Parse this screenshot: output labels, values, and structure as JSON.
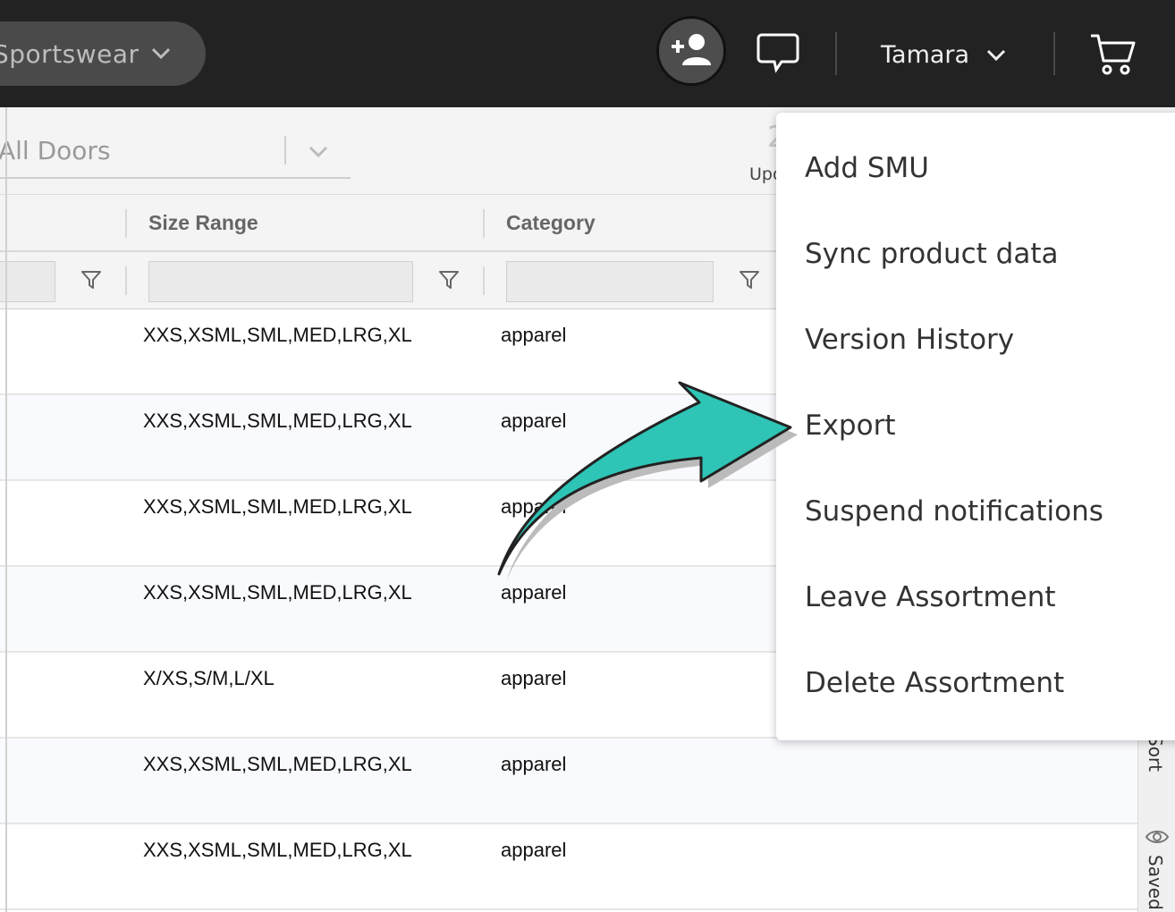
{
  "header": {
    "collection_label": "Sportswear",
    "user_name": "Tamara"
  },
  "toolbar": {
    "doors_label": "All Doors",
    "partial_count": "2",
    "partial_update_label": "Upo"
  },
  "table": {
    "columns": [
      {
        "label": "Size Range"
      },
      {
        "label": "Category"
      }
    ],
    "rows": [
      {
        "size_range": "XXS,XSML,SML,MED,LRG,XL",
        "category": "apparel"
      },
      {
        "size_range": "XXS,XSML,SML,MED,LRG,XL",
        "category": "apparel"
      },
      {
        "size_range": "XXS,XSML,SML,MED,LRG,XL",
        "category": "apparel"
      },
      {
        "size_range": "XXS,XSML,SML,MED,LRG,XL",
        "category": "apparel"
      },
      {
        "size_range": "X/XS,S/M,L/XL",
        "category": "apparel"
      },
      {
        "size_range": "XXS,XSML,SML,MED,LRG,XL",
        "category": "apparel"
      },
      {
        "size_range": "XXS,XSML,SML,MED,LRG,XL",
        "category": "apparel"
      }
    ]
  },
  "side_panel": {
    "sort_label": "Sort",
    "saved_label": "Saved"
  },
  "menu": {
    "items": [
      {
        "label": "Add SMU"
      },
      {
        "label": "Sync product data"
      },
      {
        "label": "Version History"
      },
      {
        "label": "Export"
      },
      {
        "label": "Suspend notifications"
      },
      {
        "label": "Leave Assortment"
      },
      {
        "label": "Delete Assortment"
      }
    ]
  },
  "colors": {
    "topbar": "#222222",
    "arrow": "#2ec4b6"
  },
  "icons": [
    "chevron-down-icon",
    "add-user-icon",
    "chat-icon",
    "cart-icon",
    "filter-icon",
    "eye-icon"
  ]
}
